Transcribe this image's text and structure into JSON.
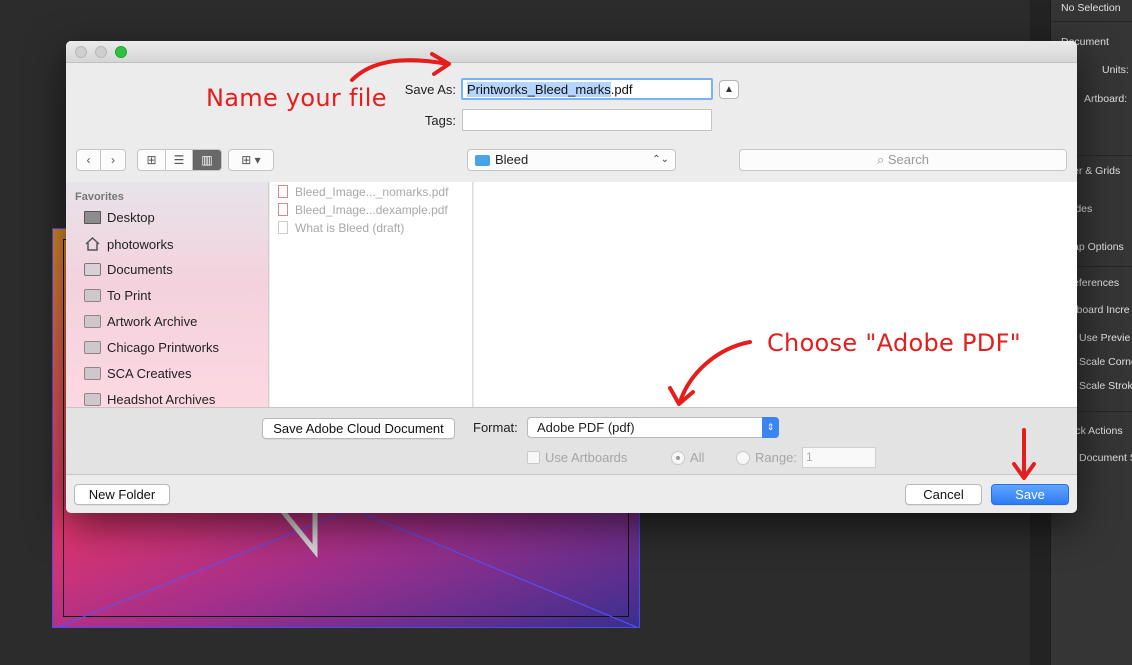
{
  "background_panel": {
    "items": [
      "No Selection",
      "Document",
      "Units:",
      "Artboard:",
      "er & Grids",
      "ides",
      "ap Options",
      "eferences",
      "rboard Incre",
      "Use Previe",
      "Scale Corne",
      "Scale Strok",
      "ick Actions",
      "Document S"
    ]
  },
  "dialog": {
    "save_as_label": "Save As:",
    "filename_selected": "Printworks_Bleed_marks",
    "filename_ext": ".pdf",
    "expand_icon": "chevron-up-icon",
    "tags_label": "Tags:",
    "tags_value": "",
    "location": "Bleed",
    "search_placeholder": "Search",
    "sidebar": {
      "header": "Favorites",
      "items": [
        {
          "label": "Desktop",
          "icon": "desktop-icon"
        },
        {
          "label": "photoworks",
          "icon": "home-icon"
        },
        {
          "label": "Documents",
          "icon": "documents-icon"
        },
        {
          "label": "To Print",
          "icon": "folder-icon"
        },
        {
          "label": "Artwork Archive",
          "icon": "folder-icon"
        },
        {
          "label": "Chicago Printworks",
          "icon": "folder-icon"
        },
        {
          "label": "SCA Creatives",
          "icon": "folder-icon"
        },
        {
          "label": "Headshot Archives",
          "icon": "folder-icon"
        }
      ]
    },
    "files": [
      {
        "name": "Bleed_Image..._nomarks.pdf",
        "icon": "pdf-file-icon"
      },
      {
        "name": "Bleed_Image...dexample.pdf",
        "icon": "pdf-file-icon"
      },
      {
        "name": "What is Bleed (draft)",
        "icon": "document-file-icon"
      }
    ],
    "cloud_button": "Save Adobe Cloud Document",
    "format_label": "Format:",
    "format_value": "Adobe PDF (pdf)",
    "use_artboards": "Use Artboards",
    "all_label": "All",
    "range_label": "Range:",
    "range_value": "1",
    "new_folder": "New Folder",
    "cancel": "Cancel",
    "save": "Save"
  },
  "annotations": {
    "name_file": "Name your file",
    "choose_pdf": "Choose \"Adobe PDF\"",
    "color": "#e61d1d"
  },
  "colors": {
    "accent": "#2e7bf5",
    "selection": "#b5d5fb"
  }
}
